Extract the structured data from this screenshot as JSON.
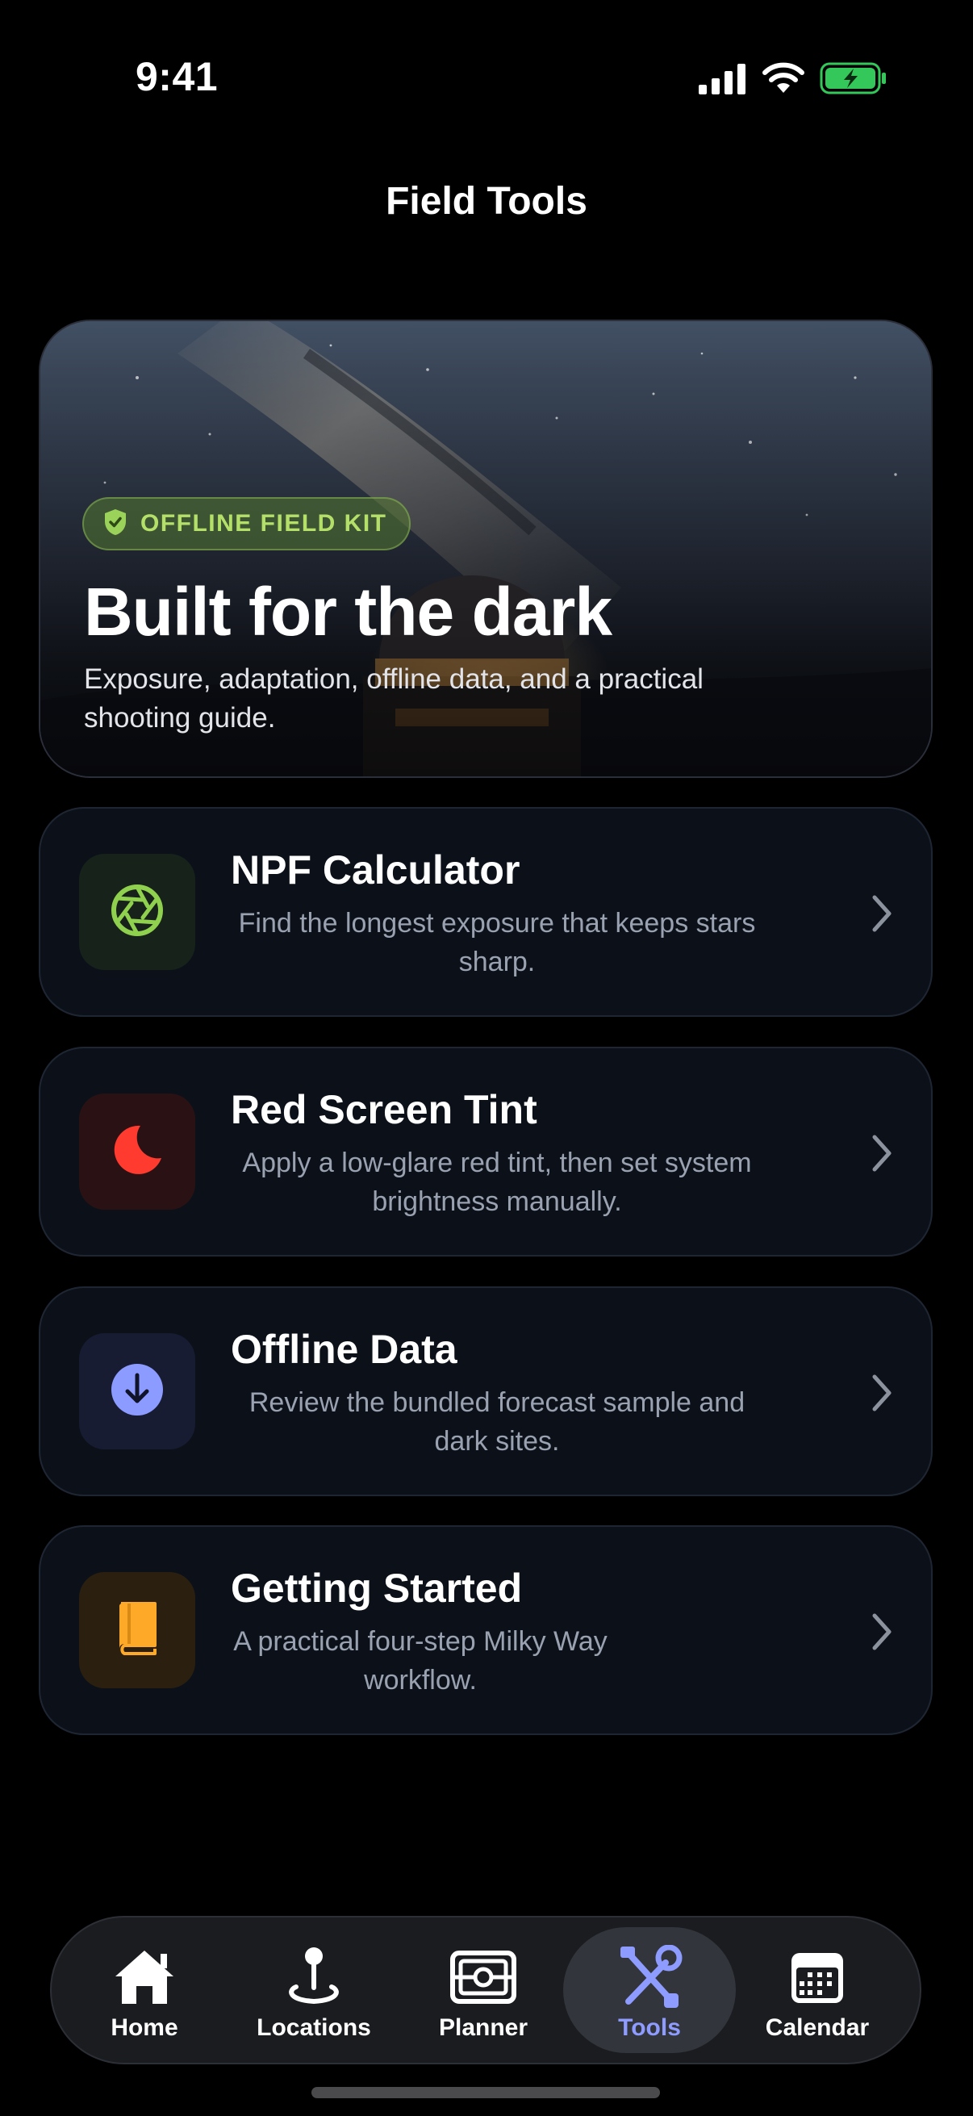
{
  "status_bar": {
    "time": "9:41",
    "icons": [
      "cellular-signal-icon",
      "wifi-icon",
      "battery-charging-icon"
    ],
    "battery_color": "#34c759"
  },
  "page": {
    "title": "Field Tools"
  },
  "hero": {
    "badge": "OFFLINE FIELD KIT",
    "badge_icon": "shield-check-icon",
    "title": "Built for the dark",
    "subtitle": "Exposure, adaptation, offline data, and a practical shooting guide."
  },
  "tools": [
    {
      "title": "NPF Calculator",
      "description": "Find the longest exposure that keeps stars sharp.",
      "icon": "aperture-icon",
      "accent": "#8fd14f"
    },
    {
      "title": "Red Screen Tint",
      "description": "Apply a low-glare red tint, then set system brightness manually.",
      "icon": "moon-icon",
      "accent": "#ff3b30"
    },
    {
      "title": "Offline Data",
      "description": "Review the bundled forecast sample and dark sites.",
      "icon": "download-circle-icon",
      "accent": "#8c9bff"
    },
    {
      "title": "Getting Started",
      "description": "A practical four-step Milky Way workflow.",
      "icon": "book-icon",
      "accent": "#ffa928"
    }
  ],
  "tab_bar": {
    "active": "Tools",
    "active_color": "#8e9bff",
    "items": [
      {
        "label": "Home",
        "icon": "house-icon"
      },
      {
        "label": "Locations",
        "icon": "map-pin-icon"
      },
      {
        "label": "Planner",
        "icon": "planner-icon"
      },
      {
        "label": "Tools",
        "icon": "tools-icon"
      },
      {
        "label": "Calendar",
        "icon": "calendar-icon"
      }
    ]
  }
}
